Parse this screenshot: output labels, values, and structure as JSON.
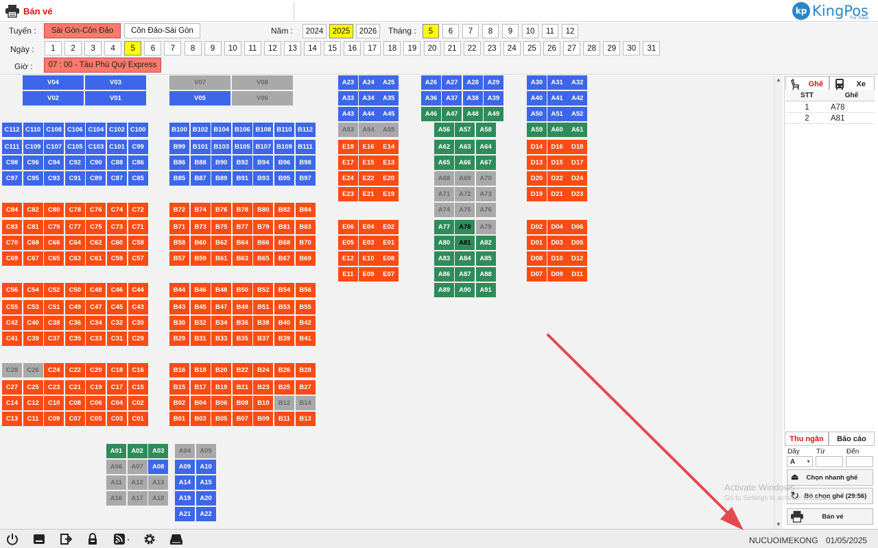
{
  "app": {
    "title": "Bán vé",
    "logo_text": "KingPos",
    "logo_sub": "For Ticket",
    "logo_mark": "kp"
  },
  "filters": {
    "route_label": "Tuyến :",
    "routes": [
      {
        "label": "Sài Gòn-Côn Đảo",
        "selected": true
      },
      {
        "label": "Côn Đảo-Sài Gòn",
        "selected": false
      }
    ],
    "year_label": "Năm :",
    "years": [
      {
        "label": "2024"
      },
      {
        "label": "2025",
        "selected": true
      },
      {
        "label": "2026"
      }
    ],
    "month_label": "Tháng :",
    "months": [
      "5",
      "6",
      "7",
      "8",
      "9",
      "10",
      "11",
      "12"
    ],
    "selected_month": "5",
    "day_label": "Ngày :",
    "days": [
      "1",
      "2",
      "3",
      "4",
      "5",
      "6",
      "7",
      "8",
      "9",
      "10",
      "11",
      "12",
      "13",
      "14",
      "15",
      "16",
      "17",
      "18",
      "19",
      "20",
      "21",
      "22",
      "23",
      "24",
      "25",
      "26",
      "27",
      "28",
      "29",
      "30",
      "31"
    ],
    "selected_day": "5",
    "time_label": "Giờ :",
    "time_value": "07 : 00 - Tàu Phú Quý Express"
  },
  "seats": [
    {
      "l": "V04",
      "c": "B"
    },
    {
      "l": "V03",
      "c": "B"
    },
    {
      "l": "V07",
      "c": "X"
    },
    {
      "l": "V08",
      "c": "X"
    },
    {
      "l": "V02",
      "c": "B"
    },
    {
      "l": "V01",
      "c": "B"
    },
    {
      "l": "V05",
      "c": "B"
    },
    {
      "l": "V06",
      "c": "X"
    },
    {
      "l": "A23",
      "c": "B"
    },
    {
      "l": "A24",
      "c": "B"
    },
    {
      "l": "A25",
      "c": "B"
    },
    {
      "l": "A33",
      "c": "B"
    },
    {
      "l": "A34",
      "c": "B"
    },
    {
      "l": "A35",
      "c": "B"
    },
    {
      "l": "A43",
      "c": "B"
    },
    {
      "l": "A44",
      "c": "B"
    },
    {
      "l": "A45",
      "c": "B"
    },
    {
      "l": "A53",
      "c": "X"
    },
    {
      "l": "A54",
      "c": "X"
    },
    {
      "l": "A55",
      "c": "X"
    },
    {
      "l": "E18",
      "c": "O"
    },
    {
      "l": "E16",
      "c": "O"
    },
    {
      "l": "E14",
      "c": "O"
    },
    {
      "l": "E17",
      "c": "O"
    },
    {
      "l": "E15",
      "c": "O"
    },
    {
      "l": "E13",
      "c": "O"
    },
    {
      "l": "E24",
      "c": "O"
    },
    {
      "l": "E22",
      "c": "O"
    },
    {
      "l": "E20",
      "c": "O"
    },
    {
      "l": "E23",
      "c": "O"
    },
    {
      "l": "E21",
      "c": "O"
    },
    {
      "l": "E19",
      "c": "O"
    },
    {
      "l": "E06",
      "c": "O"
    },
    {
      "l": "E04",
      "c": "O"
    },
    {
      "l": "E02",
      "c": "O"
    },
    {
      "l": "E05",
      "c": "O"
    },
    {
      "l": "E03",
      "c": "O"
    },
    {
      "l": "E01",
      "c": "O"
    },
    {
      "l": "E12",
      "c": "O"
    },
    {
      "l": "E10",
      "c": "O"
    },
    {
      "l": "E08",
      "c": "O"
    },
    {
      "l": "E11",
      "c": "O"
    },
    {
      "l": "E09",
      "c": "O"
    },
    {
      "l": "E07",
      "c": "O"
    },
    {
      "l": "A26",
      "c": "B"
    },
    {
      "l": "A27",
      "c": "B"
    },
    {
      "l": "A28",
      "c": "B"
    },
    {
      "l": "A29",
      "c": "B"
    },
    {
      "l": "A36",
      "c": "B"
    },
    {
      "l": "A37",
      "c": "B"
    },
    {
      "l": "A38",
      "c": "B"
    },
    {
      "l": "A39",
      "c": "B"
    },
    {
      "l": "A46",
      "c": "G"
    },
    {
      "l": "A47",
      "c": "G"
    },
    {
      "l": "A48",
      "c": "G"
    },
    {
      "l": "A49",
      "c": "G"
    },
    {
      "l": "A56",
      "c": "G"
    },
    {
      "l": "A57",
      "c": "G"
    },
    {
      "l": "A58",
      "c": "G"
    },
    {
      "l": "A62",
      "c": "G"
    },
    {
      "l": "A63",
      "c": "G"
    },
    {
      "l": "A64",
      "c": "G"
    },
    {
      "l": "A65",
      "c": "G"
    },
    {
      "l": "A66",
      "c": "G"
    },
    {
      "l": "A67",
      "c": "G"
    },
    {
      "l": "A68",
      "c": "X"
    },
    {
      "l": "A69",
      "c": "X"
    },
    {
      "l": "A70",
      "c": "X"
    },
    {
      "l": "A71",
      "c": "X"
    },
    {
      "l": "A72",
      "c": "X"
    },
    {
      "l": "A73",
      "c": "X"
    },
    {
      "l": "A74",
      "c": "X"
    },
    {
      "l": "A75",
      "c": "X"
    },
    {
      "l": "A76",
      "c": "X"
    },
    {
      "l": "A77",
      "c": "G"
    },
    {
      "l": "A78",
      "c": "K"
    },
    {
      "l": "A79",
      "c": "X"
    },
    {
      "l": "A80",
      "c": "G"
    },
    {
      "l": "A81",
      "c": "K"
    },
    {
      "l": "A82",
      "c": "G"
    },
    {
      "l": "A83",
      "c": "G"
    },
    {
      "l": "A84",
      "c": "G"
    },
    {
      "l": "A85",
      "c": "G"
    },
    {
      "l": "A86",
      "c": "G"
    },
    {
      "l": "A87",
      "c": "G"
    },
    {
      "l": "A88",
      "c": "G"
    },
    {
      "l": "A89",
      "c": "G"
    },
    {
      "l": "A90",
      "c": "G"
    },
    {
      "l": "A91",
      "c": "G"
    },
    {
      "l": "A30",
      "c": "B"
    },
    {
      "l": "A31",
      "c": "B"
    },
    {
      "l": "A32",
      "c": "B"
    },
    {
      "l": "A40",
      "c": "B"
    },
    {
      "l": "A41",
      "c": "B"
    },
    {
      "l": "A42",
      "c": "B"
    },
    {
      "l": "A50",
      "c": "B"
    },
    {
      "l": "A51",
      "c": "B"
    },
    {
      "l": "A52",
      "c": "B"
    },
    {
      "l": "A59",
      "c": "G"
    },
    {
      "l": "A60",
      "c": "G"
    },
    {
      "l": "A61",
      "c": "G"
    },
    {
      "l": "D14",
      "c": "O"
    },
    {
      "l": "D16",
      "c": "O"
    },
    {
      "l": "D18",
      "c": "O"
    },
    {
      "l": "D13",
      "c": "O"
    },
    {
      "l": "D15",
      "c": "O"
    },
    {
      "l": "D17",
      "c": "O"
    },
    {
      "l": "D20",
      "c": "O"
    },
    {
      "l": "D22",
      "c": "O"
    },
    {
      "l": "D24",
      "c": "O"
    },
    {
      "l": "D19",
      "c": "O"
    },
    {
      "l": "D21",
      "c": "O"
    },
    {
      "l": "D23",
      "c": "O"
    },
    {
      "l": "D02",
      "c": "O"
    },
    {
      "l": "D04",
      "c": "O"
    },
    {
      "l": "D06",
      "c": "O"
    },
    {
      "l": "D01",
      "c": "O"
    },
    {
      "l": "D03",
      "c": "O"
    },
    {
      "l": "D05",
      "c": "O"
    },
    {
      "l": "D08",
      "c": "O"
    },
    {
      "l": "D10",
      "c": "O"
    },
    {
      "l": "D12",
      "c": "O"
    },
    {
      "l": "D07",
      "c": "O"
    },
    {
      "l": "D09",
      "c": "O"
    },
    {
      "l": "D11",
      "c": "O"
    },
    {
      "l": "C112",
      "c": "B"
    },
    {
      "l": "C110",
      "c": "B"
    },
    {
      "l": "C108",
      "c": "B"
    },
    {
      "l": "C106",
      "c": "B"
    },
    {
      "l": "C104",
      "c": "B"
    },
    {
      "l": "C102",
      "c": "B"
    },
    {
      "l": "C100",
      "c": "B"
    },
    {
      "l": "C111",
      "c": "B"
    },
    {
      "l": "C109",
      "c": "B"
    },
    {
      "l": "C107",
      "c": "B"
    },
    {
      "l": "C105",
      "c": "B"
    },
    {
      "l": "C103",
      "c": "B"
    },
    {
      "l": "C101",
      "c": "B"
    },
    {
      "l": "C99",
      "c": "B"
    },
    {
      "l": "C98",
      "c": "B"
    },
    {
      "l": "C96",
      "c": "B"
    },
    {
      "l": "C94",
      "c": "B"
    },
    {
      "l": "C92",
      "c": "B"
    },
    {
      "l": "C90",
      "c": "B"
    },
    {
      "l": "C88",
      "c": "B"
    },
    {
      "l": "C86",
      "c": "B"
    },
    {
      "l": "C97",
      "c": "B"
    },
    {
      "l": "C95",
      "c": "B"
    },
    {
      "l": "C93",
      "c": "B"
    },
    {
      "l": "C91",
      "c": "B"
    },
    {
      "l": "C89",
      "c": "B"
    },
    {
      "l": "C87",
      "c": "B"
    },
    {
      "l": "C85",
      "c": "B"
    },
    {
      "l": "C84",
      "c": "O"
    },
    {
      "l": "C82",
      "c": "O"
    },
    {
      "l": "C80",
      "c": "O"
    },
    {
      "l": "C78",
      "c": "O"
    },
    {
      "l": "C76",
      "c": "O"
    },
    {
      "l": "C74",
      "c": "O"
    },
    {
      "l": "C72",
      "c": "O"
    },
    {
      "l": "C83",
      "c": "O"
    },
    {
      "l": "C81",
      "c": "O"
    },
    {
      "l": "C79",
      "c": "O"
    },
    {
      "l": "C77",
      "c": "O"
    },
    {
      "l": "C75",
      "c": "O"
    },
    {
      "l": "C73",
      "c": "O"
    },
    {
      "l": "C71",
      "c": "O"
    },
    {
      "l": "C70",
      "c": "O"
    },
    {
      "l": "C68",
      "c": "O"
    },
    {
      "l": "C66",
      "c": "O"
    },
    {
      "l": "C64",
      "c": "O"
    },
    {
      "l": "C62",
      "c": "O"
    },
    {
      "l": "C60",
      "c": "O"
    },
    {
      "l": "C58",
      "c": "O"
    },
    {
      "l": "C69",
      "c": "O"
    },
    {
      "l": "C67",
      "c": "O"
    },
    {
      "l": "C65",
      "c": "O"
    },
    {
      "l": "C63",
      "c": "O"
    },
    {
      "l": "C61",
      "c": "O"
    },
    {
      "l": "C59",
      "c": "O"
    },
    {
      "l": "C57",
      "c": "O"
    },
    {
      "l": "C56",
      "c": "O"
    },
    {
      "l": "C54",
      "c": "O"
    },
    {
      "l": "C52",
      "c": "O"
    },
    {
      "l": "C50",
      "c": "O"
    },
    {
      "l": "C48",
      "c": "O"
    },
    {
      "l": "C46",
      "c": "O"
    },
    {
      "l": "C44",
      "c": "O"
    },
    {
      "l": "C55",
      "c": "O"
    },
    {
      "l": "C53",
      "c": "O"
    },
    {
      "l": "C51",
      "c": "O"
    },
    {
      "l": "C49",
      "c": "O"
    },
    {
      "l": "C47",
      "c": "O"
    },
    {
      "l": "C45",
      "c": "O"
    },
    {
      "l": "C43",
      "c": "O"
    },
    {
      "l": "C42",
      "c": "O"
    },
    {
      "l": "C40",
      "c": "O"
    },
    {
      "l": "C38",
      "c": "O"
    },
    {
      "l": "C36",
      "c": "O"
    },
    {
      "l": "C34",
      "c": "O"
    },
    {
      "l": "C32",
      "c": "O"
    },
    {
      "l": "C30",
      "c": "O"
    },
    {
      "l": "C41",
      "c": "O"
    },
    {
      "l": "C39",
      "c": "O"
    },
    {
      "l": "C37",
      "c": "O"
    },
    {
      "l": "C35",
      "c": "O"
    },
    {
      "l": "C33",
      "c": "O"
    },
    {
      "l": "C31",
      "c": "O"
    },
    {
      "l": "C29",
      "c": "O"
    },
    {
      "l": "C28",
      "c": "X"
    },
    {
      "l": "C26",
      "c": "X"
    },
    {
      "l": "C24",
      "c": "O"
    },
    {
      "l": "C22",
      "c": "O"
    },
    {
      "l": "C20",
      "c": "O"
    },
    {
      "l": "C18",
      "c": "O"
    },
    {
      "l": "C16",
      "c": "O"
    },
    {
      "l": "C27",
      "c": "O"
    },
    {
      "l": "C25",
      "c": "O"
    },
    {
      "l": "C23",
      "c": "O"
    },
    {
      "l": "C21",
      "c": "O"
    },
    {
      "l": "C19",
      "c": "O"
    },
    {
      "l": "C17",
      "c": "O"
    },
    {
      "l": "C15",
      "c": "O"
    },
    {
      "l": "C14",
      "c": "O"
    },
    {
      "l": "C12",
      "c": "O"
    },
    {
      "l": "C10",
      "c": "O"
    },
    {
      "l": "C08",
      "c": "O"
    },
    {
      "l": "C06",
      "c": "O"
    },
    {
      "l": "C04",
      "c": "O"
    },
    {
      "l": "C02",
      "c": "O"
    },
    {
      "l": "C13",
      "c": "O"
    },
    {
      "l": "C11",
      "c": "O"
    },
    {
      "l": "C09",
      "c": "O"
    },
    {
      "l": "C07",
      "c": "O"
    },
    {
      "l": "C05",
      "c": "O"
    },
    {
      "l": "C03",
      "c": "O"
    },
    {
      "l": "C01",
      "c": "O"
    },
    {
      "l": "B100",
      "c": "B"
    },
    {
      "l": "B102",
      "c": "B"
    },
    {
      "l": "B104",
      "c": "B"
    },
    {
      "l": "B106",
      "c": "B"
    },
    {
      "l": "B108",
      "c": "B"
    },
    {
      "l": "B110",
      "c": "B"
    },
    {
      "l": "B112",
      "c": "B"
    },
    {
      "l": "B99",
      "c": "B"
    },
    {
      "l": "B101",
      "c": "B"
    },
    {
      "l": "B103",
      "c": "B"
    },
    {
      "l": "B105",
      "c": "B"
    },
    {
      "l": "B107",
      "c": "B"
    },
    {
      "l": "B109",
      "c": "B"
    },
    {
      "l": "B111",
      "c": "B"
    },
    {
      "l": "B86",
      "c": "B"
    },
    {
      "l": "B88",
      "c": "B"
    },
    {
      "l": "B90",
      "c": "B"
    },
    {
      "l": "B92",
      "c": "B"
    },
    {
      "l": "B94",
      "c": "B"
    },
    {
      "l": "B96",
      "c": "B"
    },
    {
      "l": "B98",
      "c": "B"
    },
    {
      "l": "B85",
      "c": "B"
    },
    {
      "l": "B87",
      "c": "B"
    },
    {
      "l": "B89",
      "c": "B"
    },
    {
      "l": "B91",
      "c": "B"
    },
    {
      "l": "B93",
      "c": "B"
    },
    {
      "l": "B95",
      "c": "B"
    },
    {
      "l": "B97",
      "c": "B"
    },
    {
      "l": "B72",
      "c": "O"
    },
    {
      "l": "B74",
      "c": "O"
    },
    {
      "l": "B76",
      "c": "O"
    },
    {
      "l": "B78",
      "c": "O"
    },
    {
      "l": "B80",
      "c": "O"
    },
    {
      "l": "B82",
      "c": "O"
    },
    {
      "l": "B84",
      "c": "O"
    },
    {
      "l": "B71",
      "c": "O"
    },
    {
      "l": "B73",
      "c": "O"
    },
    {
      "l": "B75",
      "c": "O"
    },
    {
      "l": "B77",
      "c": "O"
    },
    {
      "l": "B79",
      "c": "O"
    },
    {
      "l": "B81",
      "c": "O"
    },
    {
      "l": "B83",
      "c": "O"
    },
    {
      "l": "B58",
      "c": "O"
    },
    {
      "l": "B60",
      "c": "O"
    },
    {
      "l": "B62",
      "c": "O"
    },
    {
      "l": "B64",
      "c": "O"
    },
    {
      "l": "B66",
      "c": "O"
    },
    {
      "l": "B68",
      "c": "O"
    },
    {
      "l": "B70",
      "c": "O"
    },
    {
      "l": "B57",
      "c": "O"
    },
    {
      "l": "B59",
      "c": "O"
    },
    {
      "l": "B61",
      "c": "O"
    },
    {
      "l": "B63",
      "c": "O"
    },
    {
      "l": "B65",
      "c": "O"
    },
    {
      "l": "B67",
      "c": "O"
    },
    {
      "l": "B69",
      "c": "O"
    },
    {
      "l": "B44",
      "c": "O"
    },
    {
      "l": "B46",
      "c": "O"
    },
    {
      "l": "B48",
      "c": "O"
    },
    {
      "l": "B50",
      "c": "O"
    },
    {
      "l": "B52",
      "c": "O"
    },
    {
      "l": "B54",
      "c": "O"
    },
    {
      "l": "B56",
      "c": "O"
    },
    {
      "l": "B43",
      "c": "O"
    },
    {
      "l": "B45",
      "c": "O"
    },
    {
      "l": "B47",
      "c": "O"
    },
    {
      "l": "B49",
      "c": "O"
    },
    {
      "l": "B51",
      "c": "O"
    },
    {
      "l": "B53",
      "c": "O"
    },
    {
      "l": "B55",
      "c": "O"
    },
    {
      "l": "B30",
      "c": "O"
    },
    {
      "l": "B32",
      "c": "O"
    },
    {
      "l": "B34",
      "c": "O"
    },
    {
      "l": "B36",
      "c": "O"
    },
    {
      "l": "B38",
      "c": "O"
    },
    {
      "l": "B40",
      "c": "O"
    },
    {
      "l": "B42",
      "c": "O"
    },
    {
      "l": "B29",
      "c": "O"
    },
    {
      "l": "B31",
      "c": "O"
    },
    {
      "l": "B33",
      "c": "O"
    },
    {
      "l": "B35",
      "c": "O"
    },
    {
      "l": "B37",
      "c": "O"
    },
    {
      "l": "B39",
      "c": "O"
    },
    {
      "l": "B41",
      "c": "O"
    },
    {
      "l": "B16",
      "c": "O"
    },
    {
      "l": "B18",
      "c": "O"
    },
    {
      "l": "B20",
      "c": "O"
    },
    {
      "l": "B22",
      "c": "O"
    },
    {
      "l": "B24",
      "c": "O"
    },
    {
      "l": "B26",
      "c": "O"
    },
    {
      "l": "B28",
      "c": "O"
    },
    {
      "l": "B15",
      "c": "O"
    },
    {
      "l": "B17",
      "c": "O"
    },
    {
      "l": "B19",
      "c": "O"
    },
    {
      "l": "B21",
      "c": "O"
    },
    {
      "l": "B23",
      "c": "O"
    },
    {
      "l": "B25",
      "c": "O"
    },
    {
      "l": "B27",
      "c": "O"
    },
    {
      "l": "B02",
      "c": "O"
    },
    {
      "l": "B04",
      "c": "O"
    },
    {
      "l": "B06",
      "c": "O"
    },
    {
      "l": "B08",
      "c": "O"
    },
    {
      "l": "B10",
      "c": "O"
    },
    {
      "l": "B12",
      "c": "X"
    },
    {
      "l": "B14",
      "c": "X"
    },
    {
      "l": "B01",
      "c": "O"
    },
    {
      "l": "B03",
      "c": "O"
    },
    {
      "l": "B05",
      "c": "O"
    },
    {
      "l": "B07",
      "c": "O"
    },
    {
      "l": "B09",
      "c": "O"
    },
    {
      "l": "B11",
      "c": "O"
    },
    {
      "l": "B13",
      "c": "O"
    },
    {
      "l": "A01",
      "c": "G"
    },
    {
      "l": "A02",
      "c": "G"
    },
    {
      "l": "A03",
      "c": "G"
    },
    {
      "l": "A06",
      "c": "X"
    },
    {
      "l": "A07",
      "c": "X"
    },
    {
      "l": "A08",
      "c": "B"
    },
    {
      "l": "A11",
      "c": "X"
    },
    {
      "l": "A12",
      "c": "X"
    },
    {
      "l": "A13",
      "c": "X"
    },
    {
      "l": "A16",
      "c": "X"
    },
    {
      "l": "A17",
      "c": "X"
    },
    {
      "l": "A18",
      "c": "X"
    },
    {
      "l": "A04",
      "c": "X"
    },
    {
      "l": "A05",
      "c": "X"
    },
    {
      "l": "A09",
      "c": "B"
    },
    {
      "l": "A10",
      "c": "B"
    },
    {
      "l": "A14",
      "c": "B"
    },
    {
      "l": "A15",
      "c": "B"
    },
    {
      "l": "A19",
      "c": "B"
    },
    {
      "l": "A20",
      "c": "B"
    },
    {
      "l": "A21",
      "c": "B"
    },
    {
      "l": "A22",
      "c": "B"
    }
  ],
  "colors": {
    "available_blue": "#3d67e8",
    "sold_orange": "#fc4c13",
    "green": "#2f8c5a",
    "disabled_gray": "#a9a9a9",
    "arrow_red": "#e5484d"
  },
  "panel": {
    "tab_seat": "Ghế",
    "tab_vehicle": "Xe",
    "col_stt": "STT",
    "col_seat": "Ghế",
    "rows": [
      {
        "stt": "1",
        "seat": "A78"
      },
      {
        "stt": "2",
        "seat": "A81"
      }
    ],
    "tab_cashier": "Thu ngân",
    "tab_report": "Báo cáo",
    "label_row": "Dãy",
    "label_from": "Từ",
    "label_to": "Đến",
    "row_value": "A",
    "quick_select": "Chọn nhanh ghế",
    "deselect": "Bỏ chọn ghế (29:56)",
    "sell": "Bán vé"
  },
  "watermark": {
    "line1": "Activate Windows",
    "line2": "Go to Settings to activate Windows."
  },
  "status": {
    "user": "NUCUOIMEKONG",
    "date": "01/05/2025"
  },
  "icons": [
    "power-icon",
    "minimize-icon",
    "logout-icon",
    "lock-icon",
    "rss-icon",
    "gear-icon",
    "printer-icon"
  ]
}
